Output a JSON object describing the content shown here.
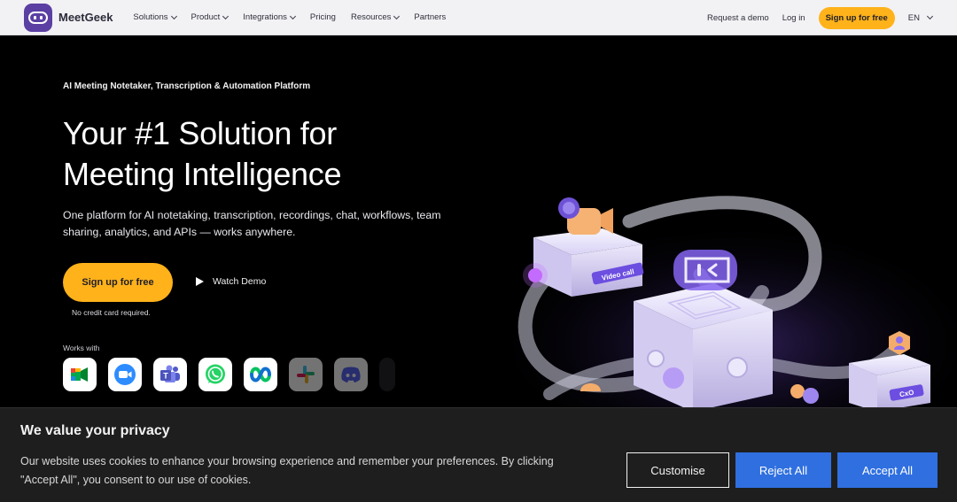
{
  "nav": {
    "brand": "MeetGeek",
    "menu": [
      {
        "label": "Solutions",
        "has_dropdown": true
      },
      {
        "label": "Product",
        "has_dropdown": true
      },
      {
        "label": "Integrations",
        "has_dropdown": true
      },
      {
        "label": "Pricing",
        "has_dropdown": false
      },
      {
        "label": "Resources",
        "has_dropdown": true
      },
      {
        "label": "Partners",
        "has_dropdown": false
      }
    ],
    "request_demo": "Request a demo",
    "login": "Log in",
    "signup": "Sign up for free",
    "language": "EN"
  },
  "hero": {
    "eyebrow": "AI Meeting Notetaker, Transcription & Automation Platform",
    "title_line1": "Your #1 Solution for",
    "title_line2": "Meeting Intelligence",
    "subtitle_line1": "One platform for AI notetaking, transcription, recordings, chat, workflows, team",
    "subtitle_line2": "sharing, analytics, and APIs — works anywhere.",
    "cta_primary": "Sign up for free",
    "cta_note": "No credit card required.",
    "cta_secondary": "Watch Demo",
    "works_with_label": "Works with",
    "integrations": [
      {
        "icon": "google-meet-icon"
      },
      {
        "icon": "zoom-icon"
      },
      {
        "icon": "microsoft-teams-icon"
      },
      {
        "icon": "whatsapp-icon"
      },
      {
        "icon": "webex-icon"
      },
      {
        "icon": "slack-icon"
      },
      {
        "icon": "discord-icon"
      }
    ],
    "illustration": {
      "video_tag": "Video call",
      "cxo_tag": "CxO"
    }
  },
  "cookie": {
    "title": "We value your privacy",
    "text_line1": "Our website uses cookies to enhance your browsing experience and remember your preferences. By clicking",
    "text_line2": "\"Accept All\", you consent to our use of cookies.",
    "customise": "Customise",
    "reject": "Reject All",
    "accept": "Accept All"
  },
  "colors": {
    "brand_purple": "#5b3fa3",
    "cta_yellow": "#ffb21a",
    "cookie_blue": "#2f6fe0"
  }
}
